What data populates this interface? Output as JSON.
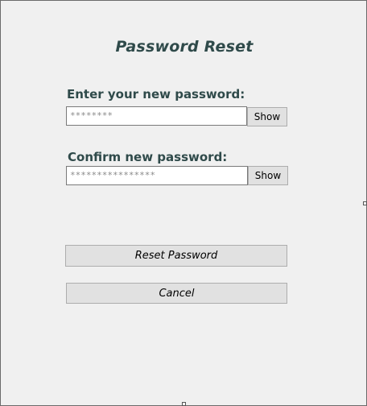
{
  "dialog": {
    "title": "Password Reset"
  },
  "new_password": {
    "label": "Enter your new password:",
    "value": "********",
    "show_label": "Show"
  },
  "confirm_password": {
    "label": "Confirm new password:",
    "value": "****************",
    "show_label": "Show"
  },
  "actions": {
    "reset_label": "Reset Password",
    "cancel_label": "Cancel"
  }
}
